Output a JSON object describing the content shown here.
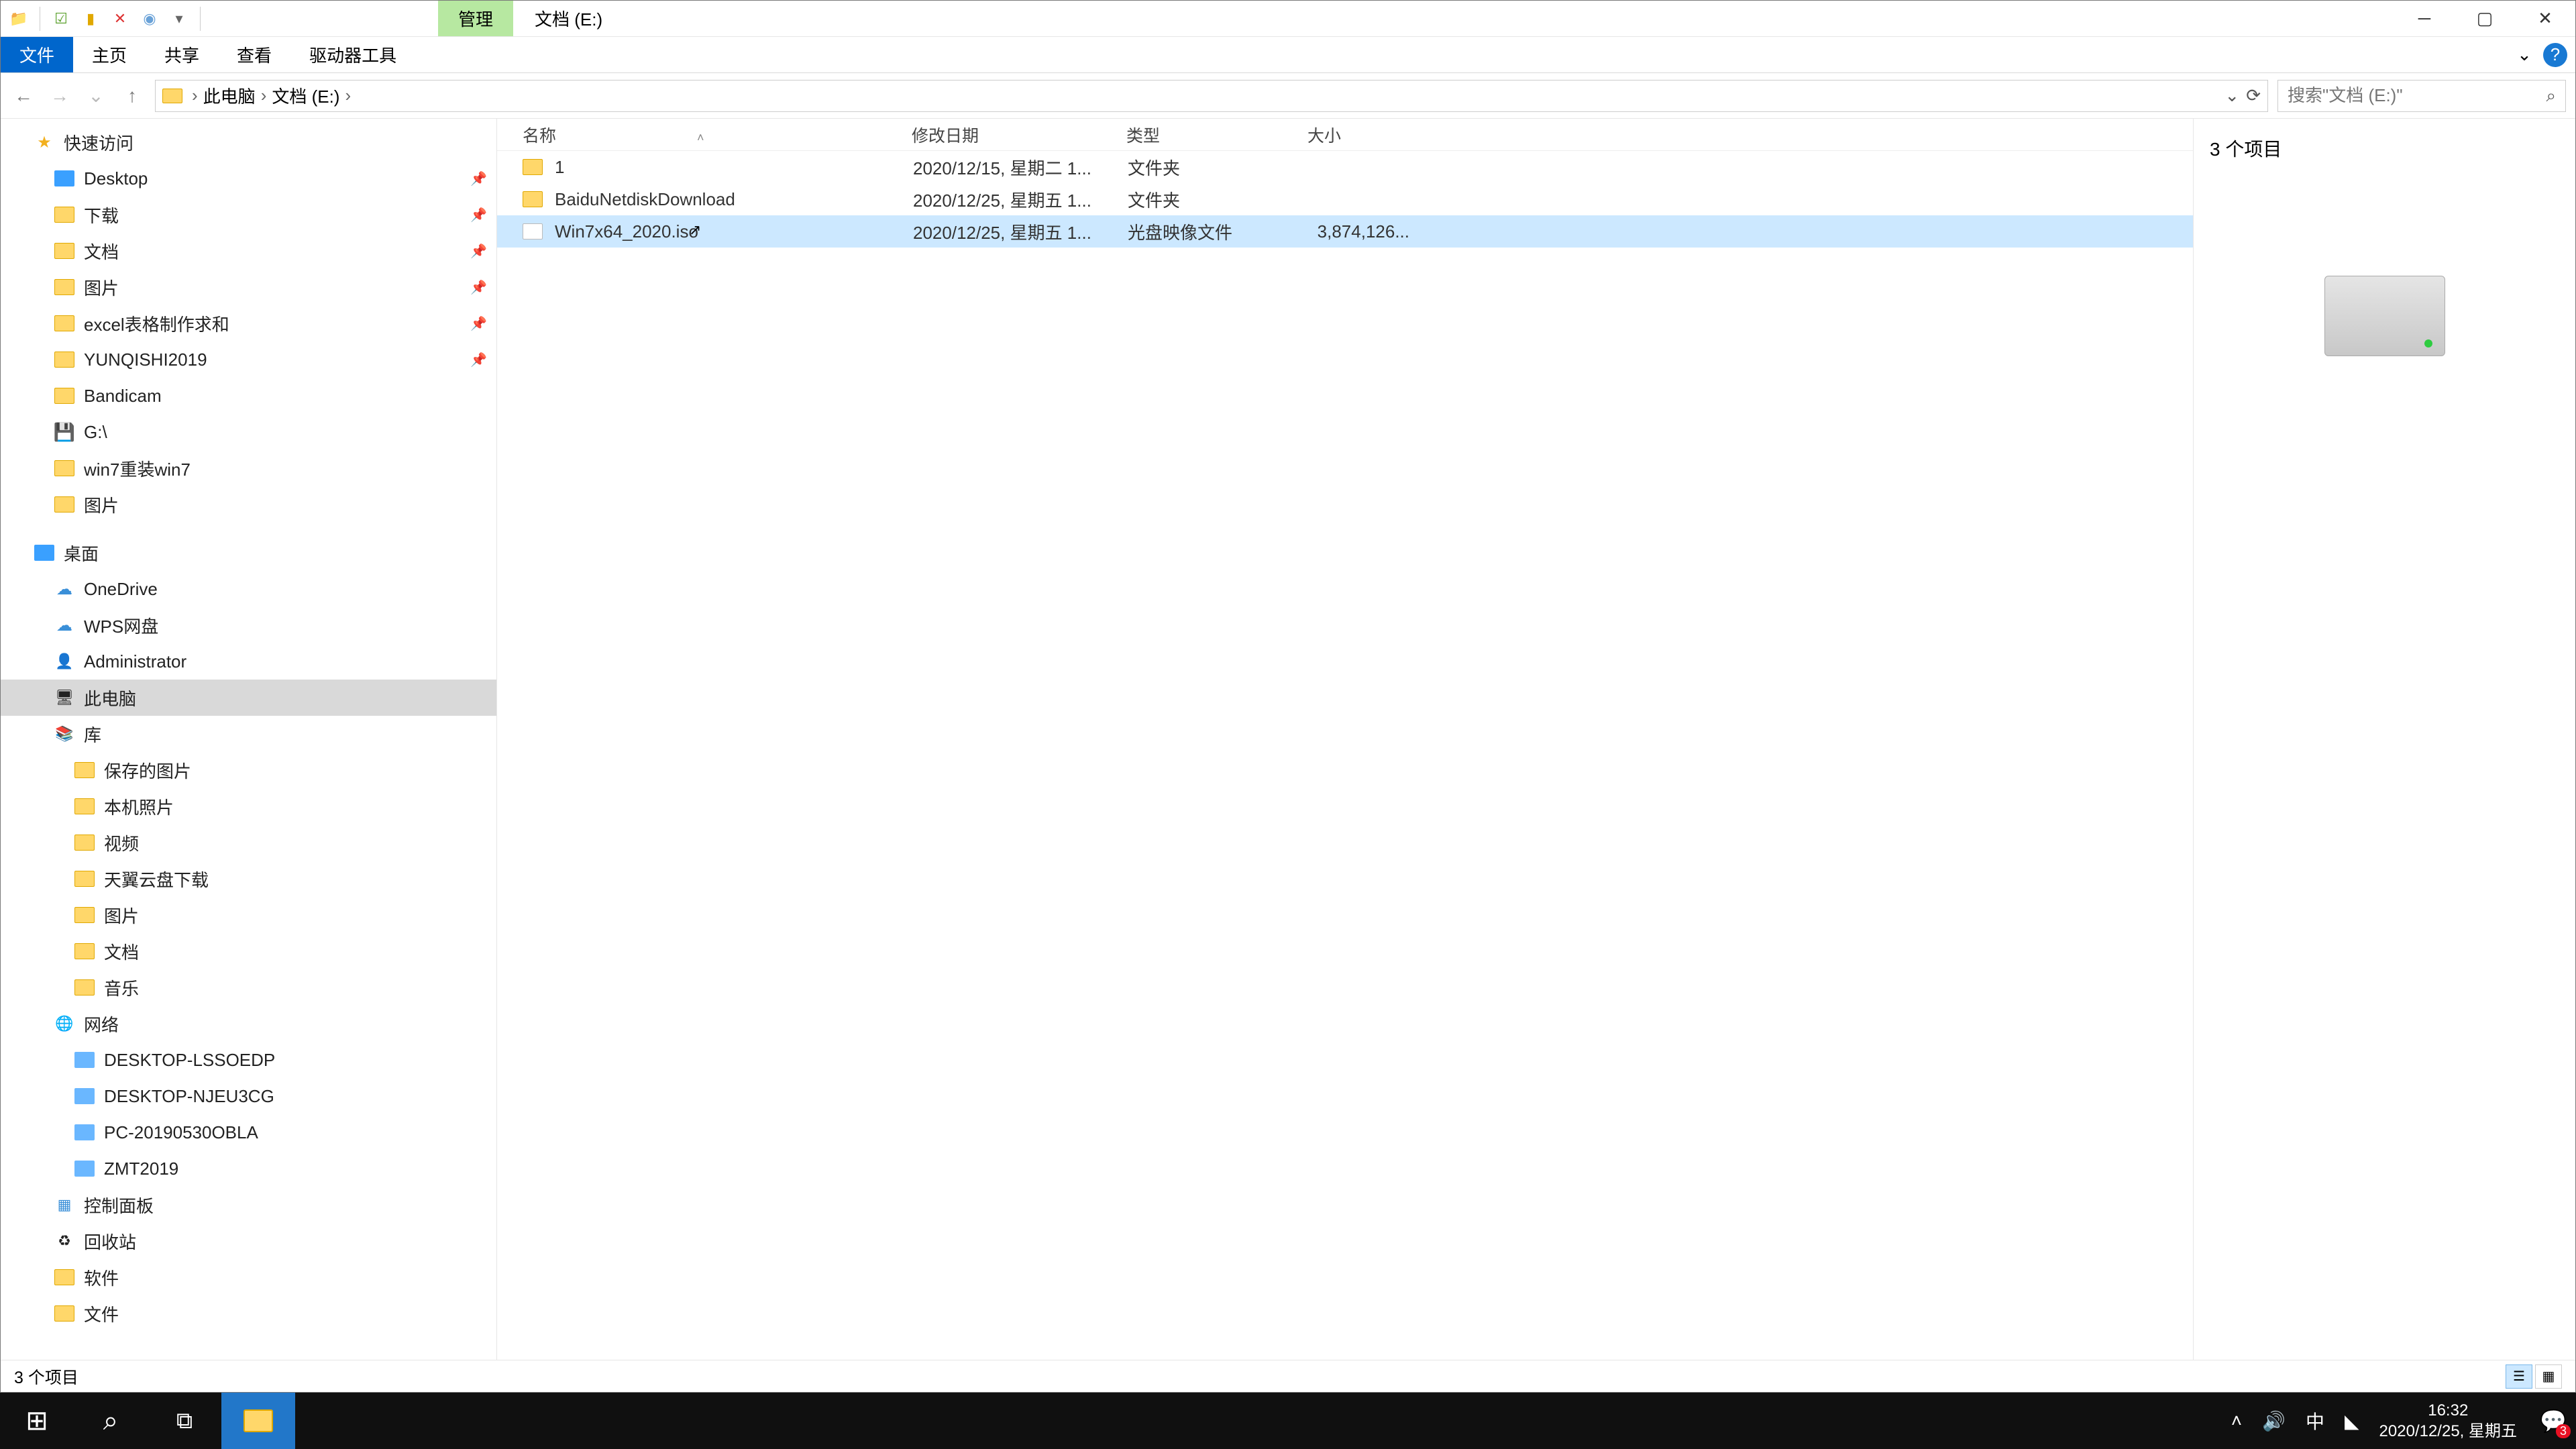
{
  "title_tab_mgmt": "管理",
  "title_path": "文档 (E:)",
  "ribbon": {
    "file": "文件",
    "home": "主页",
    "share": "共享",
    "view": "查看",
    "drive_tools": "驱动器工具"
  },
  "breadcrumb": {
    "seg1": "此电脑",
    "seg2": "文档 (E:)"
  },
  "search_placeholder": "搜索\"文档 (E:)\"",
  "columns": {
    "name": "名称",
    "date": "修改日期",
    "type": "类型",
    "size": "大小"
  },
  "files": [
    {
      "name": "1",
      "date": "2020/12/15, 星期二 1...",
      "type": "文件夹",
      "size": "",
      "icon": "folder"
    },
    {
      "name": "BaiduNetdiskDownload",
      "date": "2020/12/25, 星期五 1...",
      "type": "文件夹",
      "size": "",
      "icon": "folder"
    },
    {
      "name": "Win7x64_2020.iso",
      "date": "2020/12/25, 星期五 1...",
      "type": "光盘映像文件",
      "size": "3,874,126...",
      "icon": "iso",
      "selected": true
    }
  ],
  "preview_count": "3 个项目",
  "status_text": "3 个项目",
  "nav": {
    "quick": "快速访问",
    "desktop": "Desktop",
    "downloads": "下载",
    "documents": "文档",
    "pictures": "图片",
    "excel": "excel表格制作求和",
    "yunqishi": "YUNQISHI2019",
    "bandicam": "Bandicam",
    "g_drive": "G:\\",
    "win7reinstall": "win7重装win7",
    "pictures2": "图片",
    "desktop_cn": "桌面",
    "onedrive": "OneDrive",
    "wps": "WPS网盘",
    "admin": "Administrator",
    "thispc": "此电脑",
    "libraries": "库",
    "saved_pics": "保存的图片",
    "camera_roll": "本机照片",
    "videos": "视频",
    "tianyi": "天翼云盘下载",
    "pictures3": "图片",
    "documents2": "文档",
    "music": "音乐",
    "network": "网络",
    "pc1": "DESKTOP-LSSOEDP",
    "pc2": "DESKTOP-NJEU3CG",
    "pc3": "PC-20190530OBLA",
    "pc4": "ZMT2019",
    "ctrlpanel": "控制面板",
    "recycle": "回收站",
    "software": "软件",
    "files_folder": "文件"
  },
  "tray": {
    "ime": "中",
    "time": "16:32",
    "date": "2020/12/25, 星期五",
    "notif_count": "3"
  }
}
